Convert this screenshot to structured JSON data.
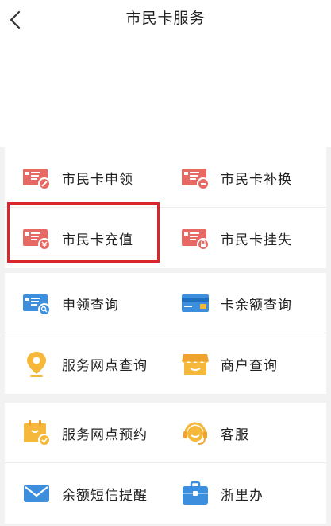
{
  "header": {
    "title": "市民卡服务",
    "back_icon": "chevron-left-icon"
  },
  "colors": {
    "red": "#e66a63",
    "blue": "#3d8fdd",
    "yellow": "#f5b83a",
    "highlight": "#d9262a"
  },
  "sections": [
    {
      "items": [
        {
          "label": "市民卡申领",
          "icon": "card-apply-icon"
        },
        {
          "label": "市民卡补换",
          "icon": "card-replace-icon"
        },
        {
          "label": "市民卡充值",
          "icon": "card-recharge-icon"
        },
        {
          "label": "市民卡挂失",
          "icon": "card-lock-icon"
        }
      ]
    },
    {
      "items": [
        {
          "label": "申领查询",
          "icon": "card-search-icon"
        },
        {
          "label": "卡余额查询",
          "icon": "credit-card-icon"
        },
        {
          "label": "服务网点查询",
          "icon": "location-pin-icon"
        },
        {
          "label": "商户查询",
          "icon": "shop-icon"
        }
      ]
    },
    {
      "items": [
        {
          "label": "服务网点预约",
          "icon": "calendar-check-icon"
        },
        {
          "label": "客服",
          "icon": "headset-icon"
        },
        {
          "label": "余额短信提醒",
          "icon": "envelope-icon"
        },
        {
          "label": "浙里办",
          "icon": "briefcase-icon"
        }
      ]
    }
  ]
}
